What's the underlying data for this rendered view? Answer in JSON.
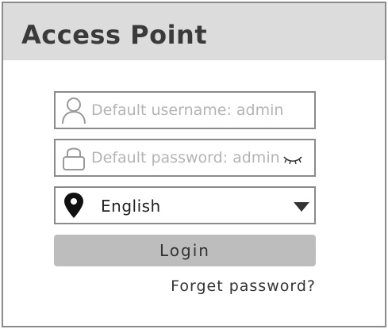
{
  "header": {
    "title": "Access Point"
  },
  "form": {
    "username_placeholder": "Default username: admin",
    "password_placeholder": "Default password: admin",
    "language_value": "English",
    "login_label": "Login",
    "forget_label": "Forget password?"
  },
  "icons": {
    "username": "user-icon",
    "password": "lock-icon",
    "visibility": "eye-closed-icon",
    "language": "location-pin-icon",
    "dropdown": "caret-down-icon"
  },
  "colors": {
    "header_bg": "#dcdcdc",
    "border": "#8a8a8a",
    "button_bg": "#bdbdbd",
    "placeholder": "#b4b4b4"
  }
}
